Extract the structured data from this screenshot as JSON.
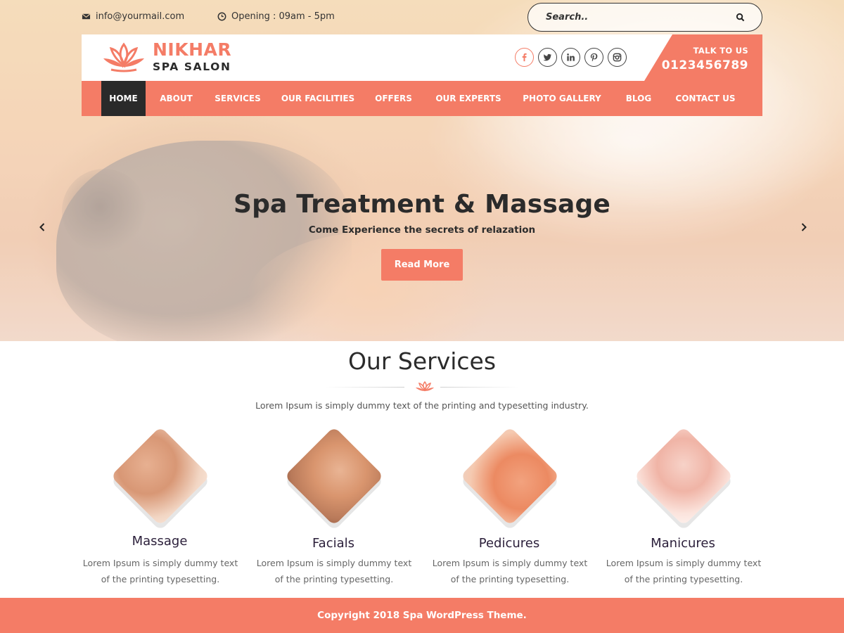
{
  "topbar": {
    "email": "info@yourmail.com",
    "hours": "Opening : 09am - 5pm",
    "search_placeholder": "Search.."
  },
  "brand": {
    "name": "NIKHAR",
    "tagline": "SPA SALON",
    "accent_color": "#f47c66"
  },
  "social": [
    "facebook-icon",
    "twitter-icon",
    "linkedin-icon",
    "pinterest-icon",
    "instagram-icon"
  ],
  "contact": {
    "label": "TALK TO US",
    "phone": "0123456789"
  },
  "nav": {
    "items": [
      {
        "label": "HOME",
        "active": true
      },
      {
        "label": "ABOUT"
      },
      {
        "label": "SERVICES"
      },
      {
        "label": "OUR FACILITIES"
      },
      {
        "label": "OFFERS"
      },
      {
        "label": "OUR EXPERTS"
      },
      {
        "label": "PHOTO GALLERY"
      },
      {
        "label": "BLOG"
      },
      {
        "label": "CONTACT US"
      }
    ]
  },
  "hero": {
    "title": "Spa Treatment & Massage",
    "subtitle": "Come Experience the secrets of relazation",
    "button": "Read More"
  },
  "services": {
    "title": "Our Services",
    "intro": "Lorem Ipsum is simply dummy text of the printing and typesetting industry.",
    "items": [
      {
        "name": "Massage",
        "desc_line1": "Lorem Ipsum is simply dummy text",
        "desc_line2": "of the printing typesetting."
      },
      {
        "name": "Facials",
        "desc_line1": "Lorem Ipsum is simply dummy text",
        "desc_line2": "of the printing typesetting."
      },
      {
        "name": "Pedicures",
        "desc_line1": "Lorem Ipsum is simply dummy text",
        "desc_line2": "of the printing typesetting."
      },
      {
        "name": "Manicures",
        "desc_line1": "Lorem Ipsum is simply dummy text",
        "desc_line2": "of the printing typesetting."
      }
    ]
  },
  "footer": {
    "copyright": "Copyright 2018 Spa WordPress Theme."
  }
}
